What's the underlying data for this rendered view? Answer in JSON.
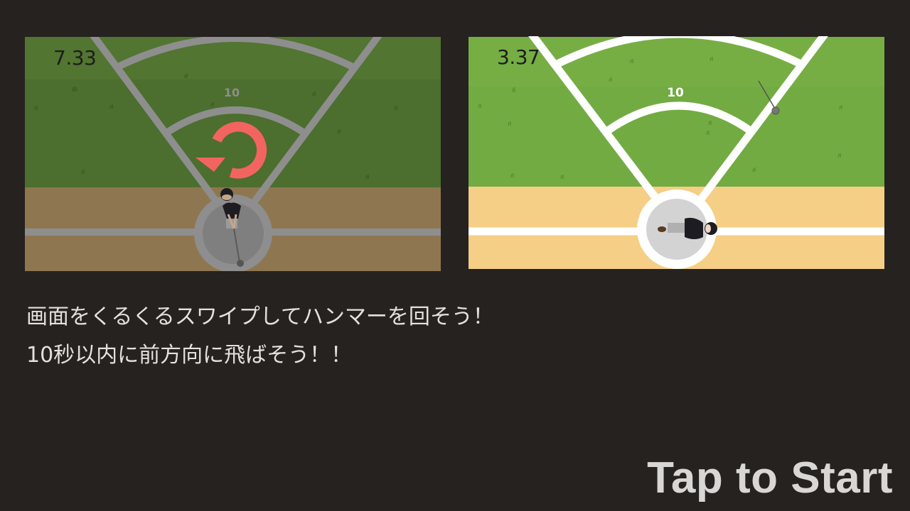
{
  "colors": {
    "background": "#262220",
    "text": "#e4e0dc",
    "start_text": "#d9d7d5",
    "arrow": "#f26460",
    "grass_dark": "#4c6e2e",
    "grass_light": "#72ab42",
    "dirt_dark": "#8e7650",
    "dirt_light": "#f5cf85",
    "lines_dark": "#8e8e8e",
    "lines_light": "#ffffff"
  },
  "preview_left": {
    "timer": "7.33",
    "distance_marker": "10",
    "arrow_icon": "rotate-counterclockwise-icon"
  },
  "preview_right": {
    "timer": "3.37",
    "distance_marker": "10"
  },
  "instructions": {
    "line1": "画面をくるくるスワイプしてハンマーを回そう！",
    "line2": "10秒以内に前方向に飛ばそう！！"
  },
  "start_label": "Tap to Start"
}
